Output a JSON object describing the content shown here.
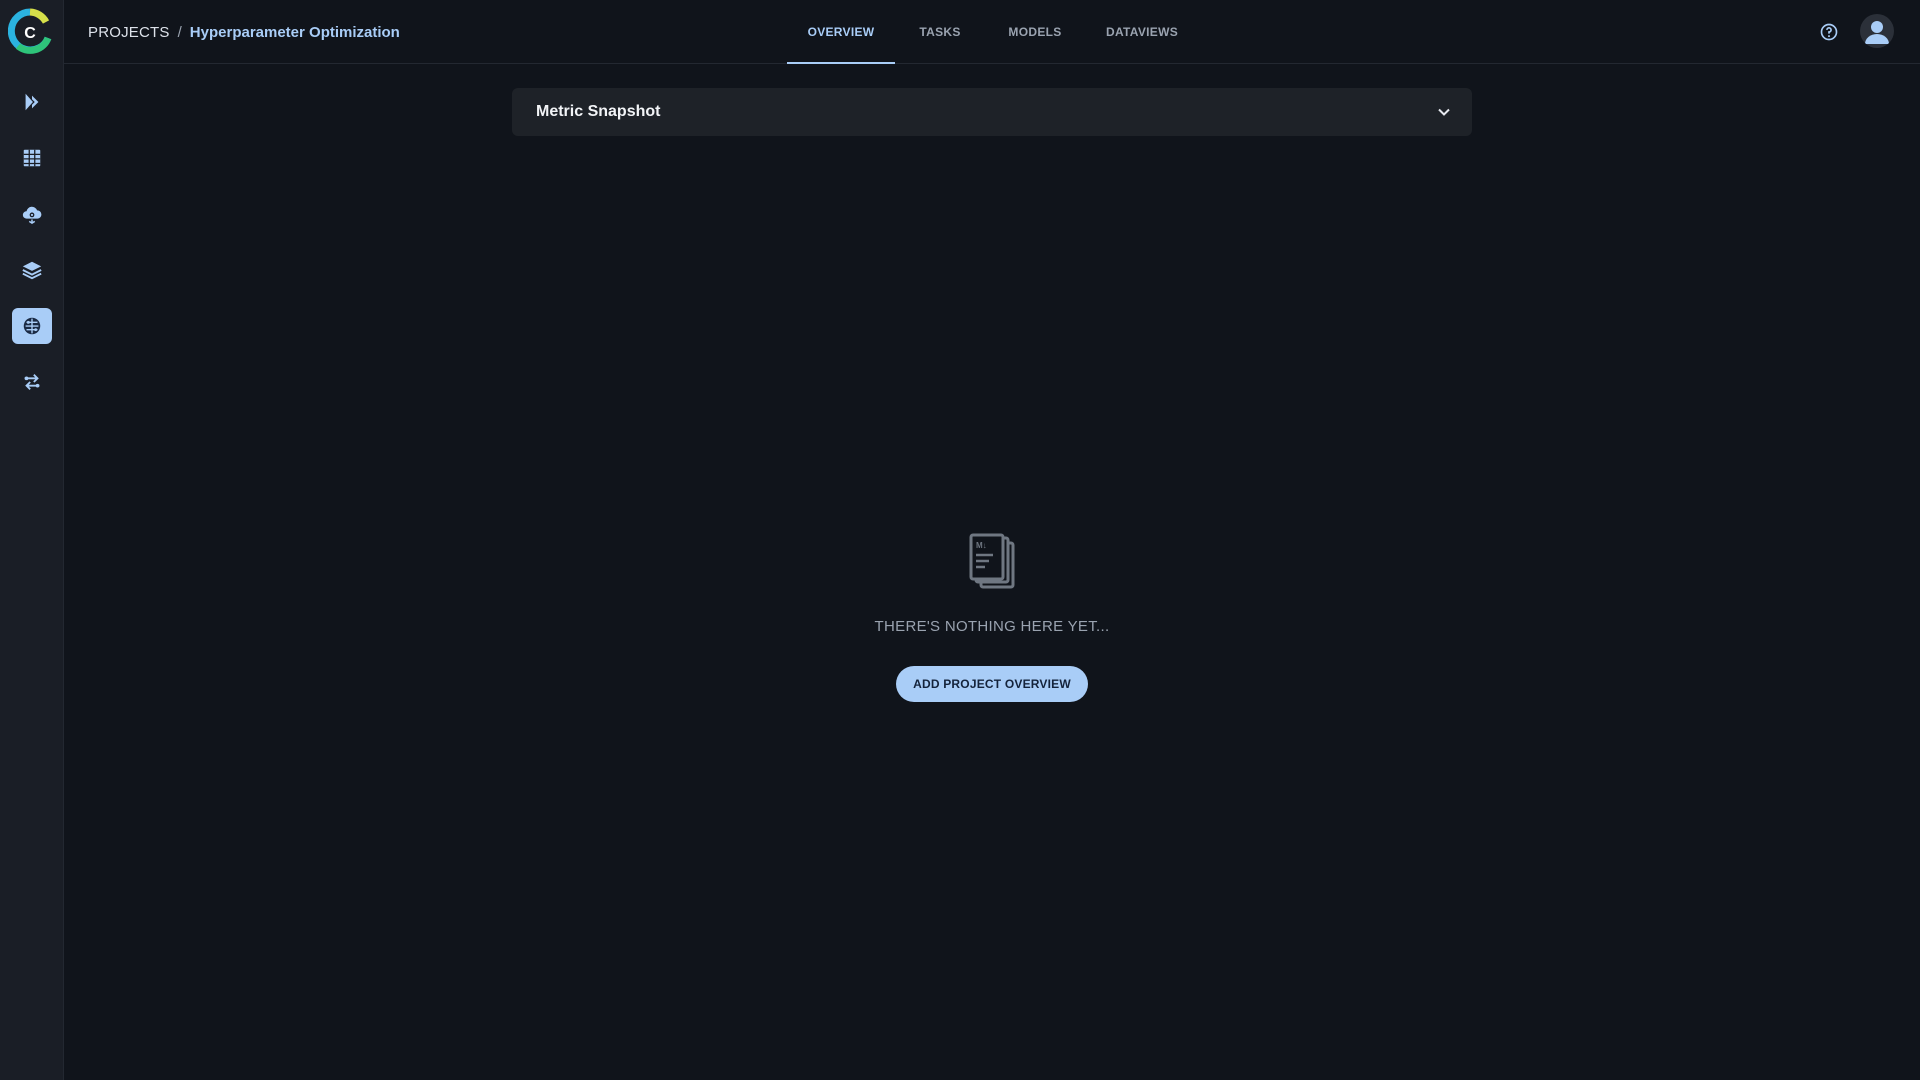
{
  "app": {
    "logo_letter": "C",
    "colors": {
      "accent": "#a9cdf7",
      "background": "#10141b",
      "sidebar": "#1a1e26",
      "panel": "#1e2228",
      "muted_text": "#9aa3b0"
    }
  },
  "sidebar": {
    "items": [
      {
        "icon": "pipeline-play-icon",
        "active": false
      },
      {
        "icon": "datasets-grid-icon",
        "active": false
      },
      {
        "icon": "cloud-gear-icon",
        "active": false
      },
      {
        "icon": "layers-icon",
        "active": false
      },
      {
        "icon": "brain-icon",
        "active": true
      },
      {
        "icon": "swap-arrows-icon",
        "active": false
      }
    ]
  },
  "header": {
    "breadcrumb": {
      "root": "PROJECTS",
      "separator": "/",
      "current": "Hyperparameter Optimization"
    },
    "tabs": [
      {
        "label": "OVERVIEW",
        "active": true
      },
      {
        "label": "TASKS",
        "active": false
      },
      {
        "label": "MODELS",
        "active": false
      },
      {
        "label": "DATAVIEWS",
        "active": false
      }
    ],
    "help_icon": "help-circle-icon",
    "avatar_icon": "user-icon"
  },
  "main": {
    "metric_snapshot": {
      "title": "Metric Snapshot",
      "expanded": false
    },
    "empty_state": {
      "icon": "markdown-documents-icon",
      "icon_label": "M↓",
      "message": "THERE'S NOTHING HERE YET...",
      "action_label": "ADD PROJECT OVERVIEW"
    }
  }
}
